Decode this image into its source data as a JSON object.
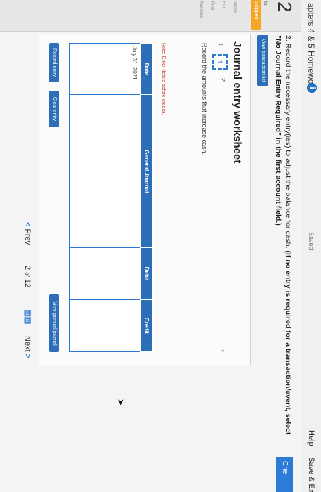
{
  "header": {
    "title": "apters 4 & 5 Homework",
    "saved": "Saved",
    "help": "Help",
    "save_exit": "Save & Ex"
  },
  "sidebar": {
    "question_number": "2",
    "label": "ts",
    "skipped": "Skipped",
    "links": [
      "ebook",
      "Hint",
      "Print",
      "ferences"
    ]
  },
  "check_label": "Che",
  "question": {
    "text": "2. Record the necessary entry(ies) to adjust the balance for cash. ",
    "bold": "(If no entry is required for a transaction/event, select \"No Journal Entry Required\" in the first account field.)"
  },
  "view_transaction_list": "View transaction list",
  "worksheet": {
    "title": "Journal entry worksheet",
    "tabs": [
      "1",
      "2"
    ],
    "instruction": "Record the amounts that increase cash.",
    "note": "Note: Enter debits before credits.",
    "columns": [
      "Date",
      "General Journal",
      "Debit",
      "Credit"
    ],
    "rows": [
      {
        "date": "July 31, 2021",
        "account": "",
        "debit": "",
        "credit": ""
      },
      {
        "date": "",
        "account": "",
        "debit": "",
        "credit": ""
      },
      {
        "date": "",
        "account": "",
        "debit": "",
        "credit": ""
      },
      {
        "date": "",
        "account": "",
        "debit": "",
        "credit": ""
      },
      {
        "date": "",
        "account": "",
        "debit": "",
        "credit": ""
      },
      {
        "date": "",
        "account": "",
        "debit": "",
        "credit": ""
      }
    ],
    "record_entry": "Record entry",
    "clear_entry": "Clear entry",
    "view_general_journal": "View general journal"
  },
  "pager": {
    "prev": "Prev",
    "page": "2",
    "of": "of",
    "total": "12",
    "next": "Next"
  },
  "icons": {
    "info": "info-icon",
    "cursor": "cursor-icon",
    "grid": "grid-icon"
  },
  "colors": {
    "accent": "#2c6fb8",
    "skipped": "#f6a623",
    "note": "#c0392b"
  }
}
